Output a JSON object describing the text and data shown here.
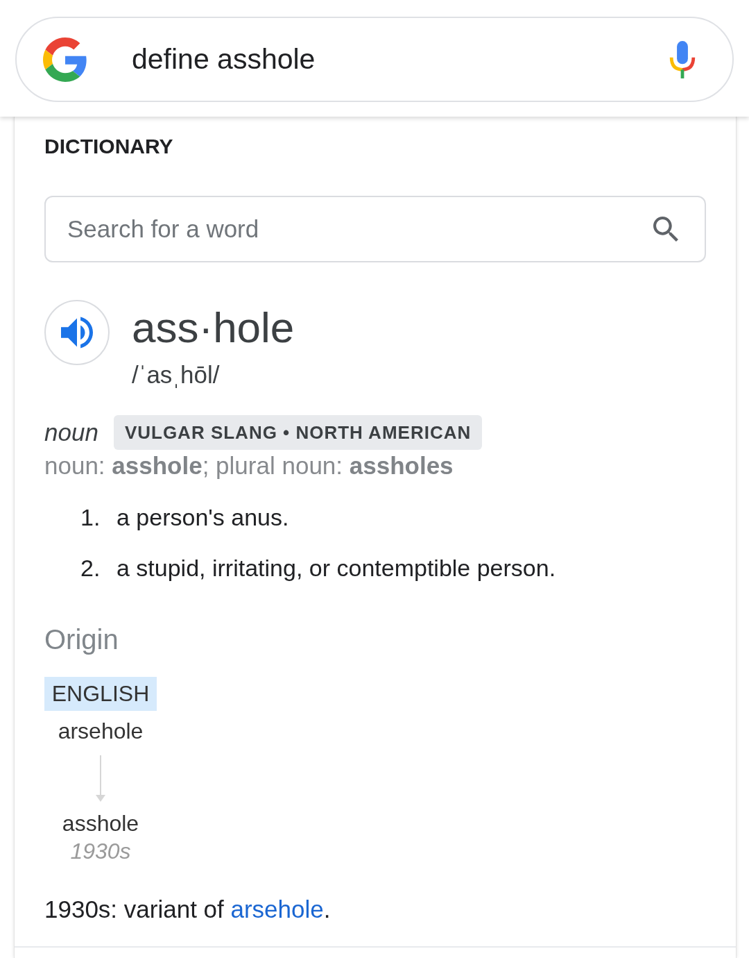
{
  "search_bar": {
    "query": "define asshole"
  },
  "dictionary": {
    "heading": "DICTIONARY",
    "word_search": {
      "placeholder": "Search for a word"
    },
    "entry": {
      "headword": "ass·hole",
      "pronunciation": "/ˈasˌhōl/",
      "part_of_speech": "noun",
      "usage_labels": "VULGAR SLANG • NORTH AMERICAN",
      "forms": "noun: **asshole**; plural noun: **assholes**",
      "senses": [
        {
          "number": "1.",
          "text": "a person's anus."
        },
        {
          "number": "2.",
          "text": "a stupid, irritating, or contemptible person."
        }
      ]
    },
    "origin": {
      "heading": "Origin",
      "diagram": [
        {
          "language": "ENGLISH",
          "word": "arsehole"
        },
        {
          "word": "asshole",
          "date": "1930s"
        }
      ],
      "note": [
        {
          "kind": "text",
          "text": "1930s: variant of "
        },
        {
          "kind": "link",
          "text": "arsehole"
        },
        {
          "kind": "text",
          "text": "."
        }
      ]
    }
  }
}
